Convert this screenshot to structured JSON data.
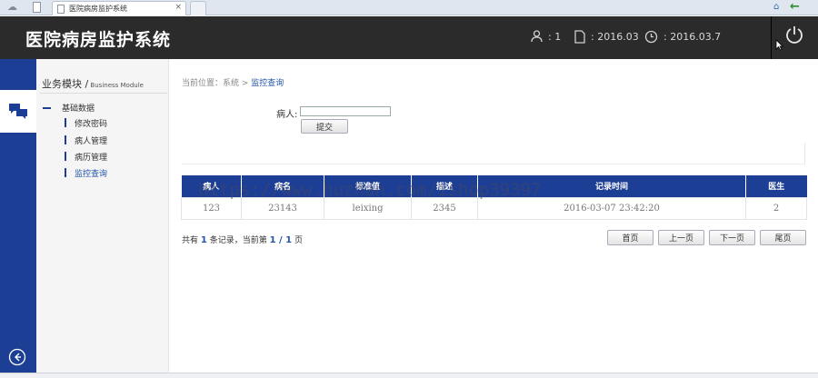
{
  "browser": {
    "tab_title": "医院病房监护系统",
    "tab_close": "×"
  },
  "header": {
    "title": "医院病房监护系统",
    "user_count": ": 1",
    "file_date": ": 2016.03",
    "clock_date": ": 2016.03.7"
  },
  "sidebar": {
    "module_title": "业务模块 /",
    "module_title_en": " Business Module",
    "group_label": "基础数据",
    "items": [
      {
        "label": "修改密码"
      },
      {
        "label": "病人管理"
      },
      {
        "label": "病历管理"
      },
      {
        "label": "监控查询"
      }
    ]
  },
  "breadcrumb": {
    "prefix": "当前位置：系统 > ",
    "current": "监控查询"
  },
  "form": {
    "patient_label": "病人:",
    "patient_value": "",
    "submit_label": "提交"
  },
  "table": {
    "columns": [
      "病人",
      "病名",
      "标准值",
      "描述",
      "记录时间",
      "医生"
    ],
    "rows": [
      [
        "123",
        "23143",
        "leixing",
        "2345",
        "2016-03-07 23:42:20",
        "2"
      ]
    ]
  },
  "watermark": "https://www.huzhan.com/ishop39397",
  "pagination": {
    "text_1": "共有 ",
    "total": "1",
    "text_2": " 条记录，当前第 ",
    "current": "1",
    "text_3": " / ",
    "pages": "1",
    "text_4": " 页",
    "first": "首页",
    "prev": "上一页",
    "next": "下一页",
    "last": "尾页"
  },
  "colors": {
    "header_bg": "#2b2b2b",
    "brand_blue": "#1c3f95",
    "link_blue": "#2255aa"
  }
}
